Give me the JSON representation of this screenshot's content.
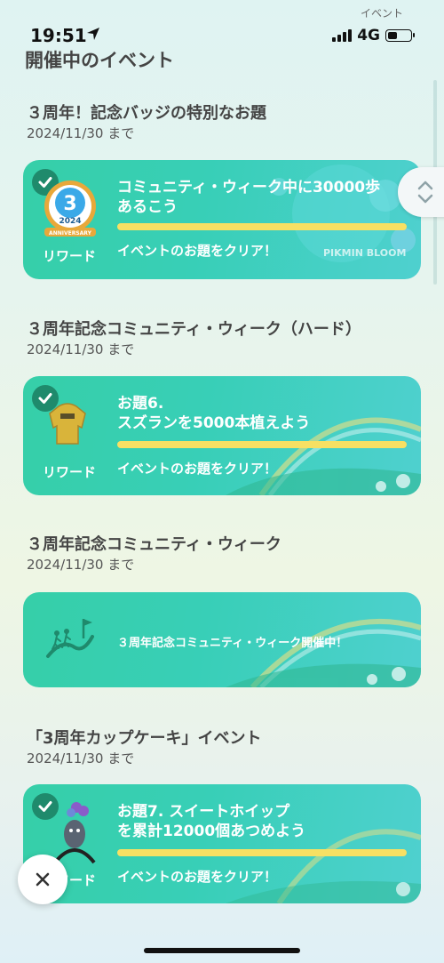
{
  "status_bar": {
    "time": "19:51",
    "network": "4G",
    "corner_label": "イベント"
  },
  "page_title": "開催中のイベント",
  "events": [
    {
      "title": "３周年！記念バッジの特別なお題",
      "date": "2024/11/30 まで",
      "reward_label": "リワード",
      "mission": "コミュニティ・ウィーク中に30000歩\nあるこう",
      "clear": "イベントのお題をクリア！",
      "badge_year": "2024",
      "badge_text": "ANNIVERSARY",
      "deco_text": "PIKMIN BLOOM"
    },
    {
      "title": "３周年記念コミュニティ・ウィーク（ハード）",
      "date": "2024/11/30 まで",
      "reward_label": "リワード",
      "mission": "お題6.\nスズランを5000本植えよう",
      "clear": "イベントのお題をクリア！"
    },
    {
      "title": "３周年記念コミュニティ・ウィーク",
      "date": "2024/11/30 まで",
      "status": "３周年記念コミュニティ・ウィーク開催中！"
    },
    {
      "title": "「3周年カップケーキ」イベント",
      "date": "2024/11/30 まで",
      "reward_label": "リワード",
      "mission": "お題7. スイートホイップ\nを累計12000個あつめよう",
      "clear": "イベントのお題をクリア！"
    }
  ],
  "icons": [
    "location-arrow-icon",
    "signal-icon",
    "battery-icon",
    "check-icon",
    "badge-icon",
    "hoodie-icon",
    "walking-people-icon",
    "pikmin-headband-icon",
    "chevron-updown-icon",
    "close-icon"
  ],
  "colors": {
    "card": "#38cfb0",
    "progress": "#f7e063",
    "check": "#1f8a6c"
  }
}
